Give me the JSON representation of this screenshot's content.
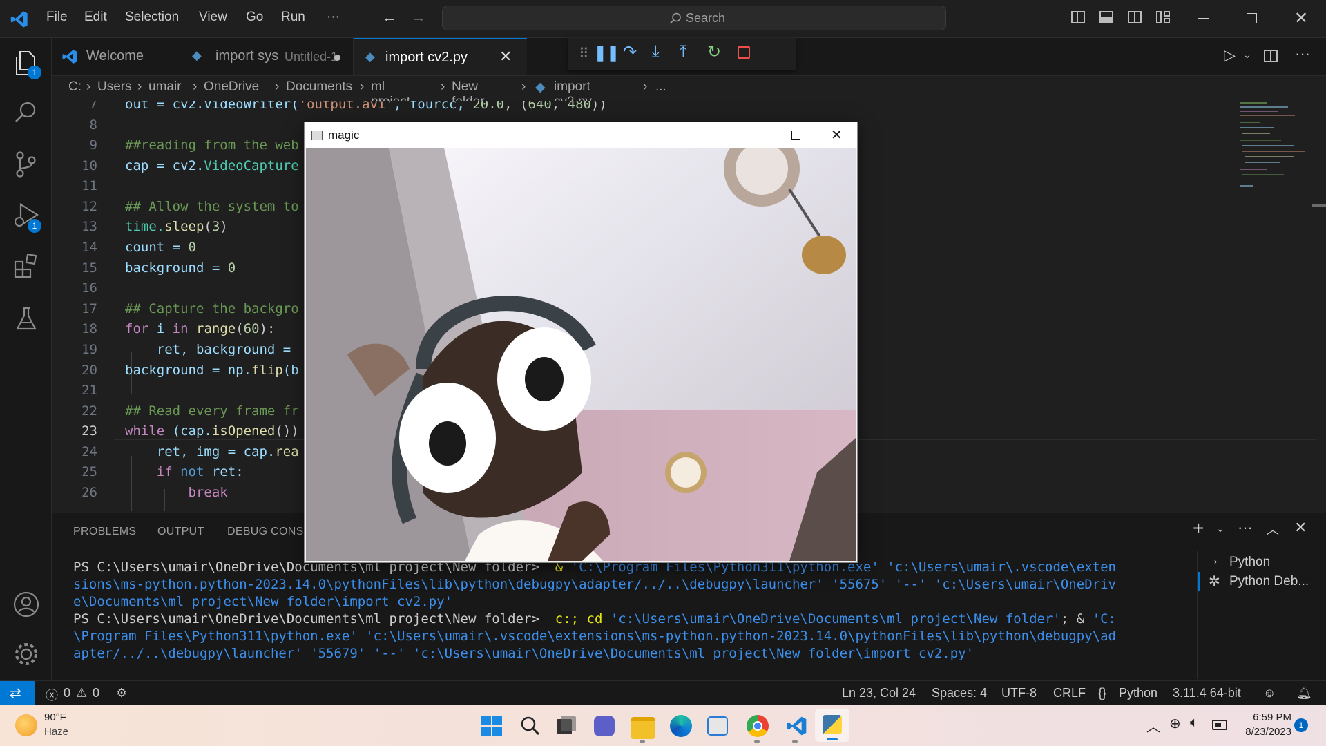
{
  "menu": [
    "File",
    "Edit",
    "Selection",
    "View",
    "Go",
    "Run",
    "···"
  ],
  "search": {
    "label": "Search"
  },
  "activity_badges": {
    "explorer": "1",
    "debug": "1"
  },
  "tabs": [
    {
      "label": "Welcome"
    },
    {
      "label": "import sys",
      "sub": "Untitled-1"
    },
    {
      "label": "import cv2.py"
    }
  ],
  "breadcrumb": [
    "C:",
    "Users",
    "umair",
    "OneDrive",
    "Documents",
    "ml project",
    "New folder",
    "import cv2.py",
    "..."
  ],
  "line_numbers": [
    "7",
    "8",
    "9",
    "10",
    "11",
    "12",
    "13",
    "14",
    "15",
    "16",
    "17",
    "18",
    "19",
    "20",
    "21",
    "22",
    "23",
    "24",
    "25",
    "26"
  ],
  "code": {
    "l7": [
      "out = cv2.VideoWriter(",
      "'output.avi'",
      ", fourcc, ",
      "20.0",
      ", (",
      "640",
      ", ",
      "480",
      "))"
    ],
    "l9": "##reading from the web",
    "l10": [
      "cap = cv2.",
      "VideoCapture"
    ],
    "l12": "## Allow the system to",
    "l13": [
      "time.",
      "sleep",
      "(",
      "3",
      ")"
    ],
    "l14": [
      "count = ",
      "0"
    ],
    "l15": [
      "background = ",
      "0"
    ],
    "l17": "## Capture the backgro",
    "l18": [
      "for",
      " i ",
      "in",
      " ",
      "range",
      "(",
      "60",
      "):"
    ],
    "l19": "    ret, background =",
    "l20": [
      "background = np.",
      "flip",
      "(b"
    ],
    "l22": "## Read every frame fr",
    "l23": [
      "while",
      " (cap.",
      "isOpened",
      "())"
    ],
    "l24": [
      "    ret, img = cap.",
      "rea"
    ],
    "l25": [
      "    ",
      "if",
      " ",
      "not",
      " ret:"
    ],
    "l26": [
      "        ",
      "break"
    ]
  },
  "panel_tabs": [
    "PROBLEMS",
    "OUTPUT",
    "DEBUG CONSOLE"
  ],
  "terminal_list": [
    "Python",
    "Python Deb..."
  ],
  "terminal": {
    "l1a": "PS C:\\Users\\umair\\OneDrive\\Documents\\ml project\\New folder> ",
    "l1b": " & ",
    "l1c": "'C:\\Program Files\\Python311\\python.exe' 'c:\\Users\\umair\\.vscode\\exten",
    "l2": "sions\\ms-python.python-2023.14.0\\pythonFiles\\lib\\python\\debugpy\\adapter/../..\\debugpy\\launcher' '55675' '--' 'c:\\Users\\umair\\OneDriv",
    "l3": "e\\Documents\\ml project\\New folder\\import cv2.py'",
    "l4a": "PS C:\\Users\\umair\\OneDrive\\Documents\\ml project\\New folder> ",
    "l4b": " c:; cd ",
    "l4c": "'c:\\Users\\umair\\OneDrive\\Documents\\ml project\\New folder'",
    "l4d": "; & ",
    "l4e": "'C:",
    "l5": "\\Program Files\\Python311\\python.exe' 'c:\\Users\\umair\\.vscode\\extensions\\ms-python.python-2023.14.0\\pythonFiles\\lib\\python\\debugpy\\ad",
    "l6": "apter/../..\\debugpy\\launcher' '55679' '--' 'c:\\Users\\umair\\OneDrive\\Documents\\ml project\\New folder\\import cv2.py'"
  },
  "status": {
    "errors": "0",
    "warnings": "0",
    "position": "Ln 23, Col 24",
    "spaces": "Spaces: 4",
    "encoding": "UTF-8",
    "eol": "CRLF",
    "language": "Python",
    "interpreter": "3.11.4 64-bit"
  },
  "magic_window": {
    "title": "magic"
  },
  "taskbar": {
    "temp": "90°F",
    "weather": "Haze",
    "time": "6:59 PM",
    "date": "8/23/2023",
    "notif": "1"
  }
}
